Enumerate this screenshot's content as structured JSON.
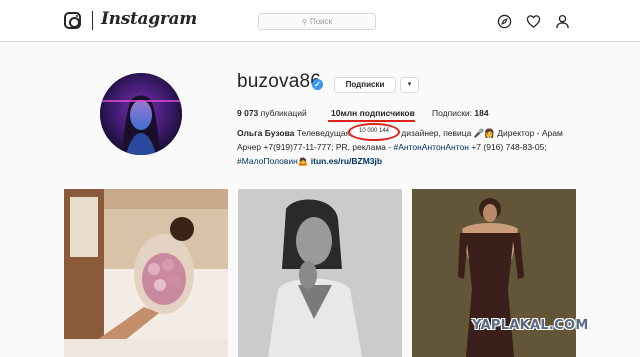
{
  "header": {
    "wordmark": "Instagram",
    "search_placeholder": "Поиск",
    "icons": [
      "instagram-camera-icon",
      "compass-icon",
      "heart-icon",
      "person-icon"
    ]
  },
  "profile": {
    "username": "buzova86",
    "verified": true,
    "subscribed_button": "Подписки",
    "dropdown_glyph": "▾",
    "stats": {
      "posts_count": "9 073",
      "posts_label": "публикаций",
      "followers": "10млн подписчиков",
      "following_label": "Подписки:",
      "following_count": "184"
    },
    "bio": {
      "name": "Ольга Бузова",
      "line1_rest": "Телеведущая,",
      "line1_tail": "дизайнер, певица 🎤👩 Директор - Арам",
      "line2": "Арчер +7(919)77-11-777; PR, реклама -",
      "line2_hashtag": "#АнтонАнтонАнтон",
      "line2_tail": "+7 (916) 748-83-05;",
      "line3_hashtag": "#МалоПоловин",
      "line3_emoji": "🙇",
      "line3_link": "itun.es/ru/BZM3jb"
    },
    "annotation_value": "10 000 144"
  },
  "watermark": "YAPLAKAL.COM",
  "colors": {
    "accent_blue": "#3897f0",
    "annotation_red": "#e0201b",
    "hashtag": "#003569",
    "border": "#dbdbdb"
  }
}
